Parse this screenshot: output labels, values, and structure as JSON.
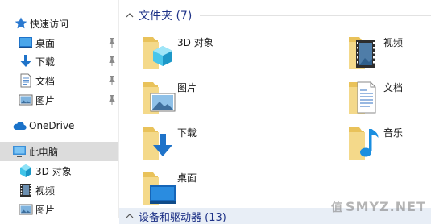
{
  "nav": {
    "quick_access": "快速访问",
    "pinned": [
      {
        "label": "桌面"
      },
      {
        "label": "下载"
      },
      {
        "label": "文档"
      },
      {
        "label": "图片"
      }
    ],
    "onedrive": "OneDrive",
    "this_pc": "此电脑",
    "pc_items": [
      {
        "label": "3D 对象"
      },
      {
        "label": "视频"
      },
      {
        "label": "图片"
      }
    ]
  },
  "content": {
    "folders_header": "文件夹 (7)",
    "folders": [
      {
        "label": "3D 对象",
        "icon": "3d-objects-folder-icon"
      },
      {
        "label": "视频",
        "icon": "videos-folder-icon"
      },
      {
        "label": "图片",
        "icon": "pictures-folder-icon"
      },
      {
        "label": "文档",
        "icon": "documents-folder-icon"
      },
      {
        "label": "下载",
        "icon": "downloads-folder-icon"
      },
      {
        "label": "音乐",
        "icon": "music-folder-icon"
      },
      {
        "label": "桌面",
        "icon": "desktop-folder-icon"
      }
    ],
    "devices_header": "设备和驱动器 (13)"
  },
  "watermark": "SMYZ.NET",
  "colors": {
    "accent": "#1e3287",
    "selected_bg": "#dcdcdc",
    "folder": "#f1d27a"
  }
}
